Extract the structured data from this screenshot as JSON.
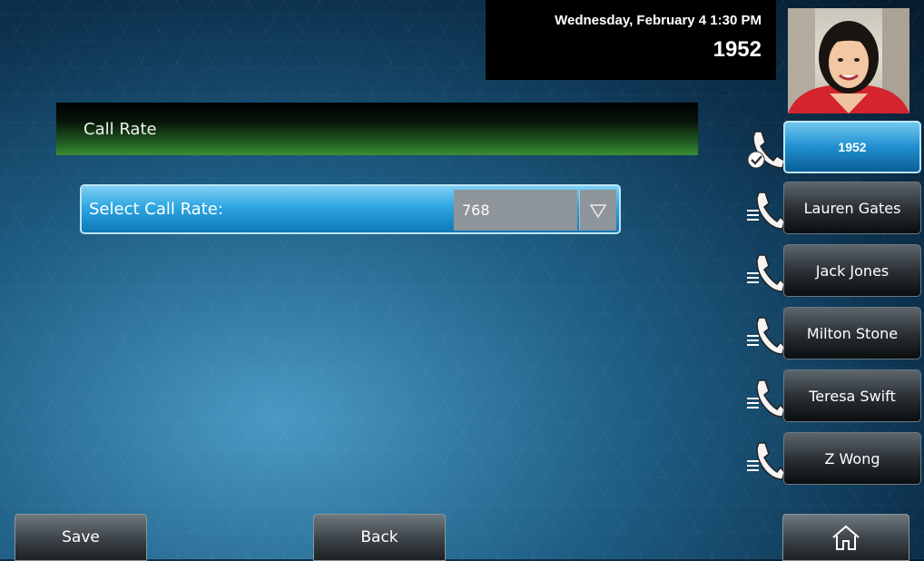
{
  "status": {
    "datetime": "Wednesday, February 4  1:30 PM",
    "extension": "1952"
  },
  "avatar": {
    "icon": "user-photo"
  },
  "section": {
    "title": "Call Rate"
  },
  "call_rate": {
    "label": "Select Call Rate:",
    "value": "768"
  },
  "lines": [
    {
      "label": "1952",
      "icon": "phone-registered-icon",
      "active": true
    },
    {
      "label": "Lauren Gates",
      "icon": "phone-contact-icon"
    },
    {
      "label": "Jack Jones",
      "icon": "phone-contact-icon"
    },
    {
      "label": "Milton Stone",
      "icon": "phone-contact-icon"
    },
    {
      "label": "Teresa Swift",
      "icon": "phone-contact-icon"
    },
    {
      "label": "Z Wong",
      "icon": "phone-contact-icon"
    }
  ],
  "softkeys": {
    "save": "Save",
    "back": "Back",
    "home_icon": "home-icon"
  },
  "colors": {
    "accent_blue": "#1f8fd0",
    "header_green": "#3c8e33"
  }
}
